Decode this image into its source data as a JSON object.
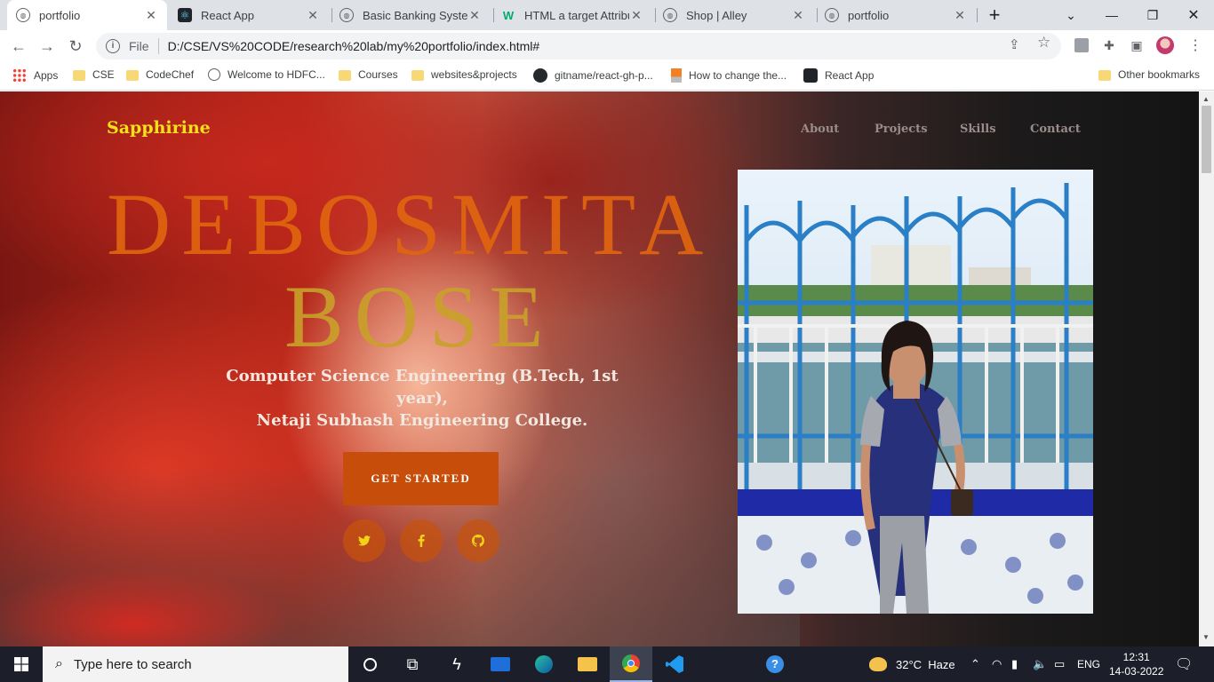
{
  "browser": {
    "tabs": [
      {
        "label": "portfolio",
        "active": true
      },
      {
        "label": "React App",
        "active": false
      },
      {
        "label": "Basic Banking System",
        "active": false
      },
      {
        "label": "HTML a target Attribu",
        "active": false
      },
      {
        "label": "Shop | Alley",
        "active": false
      },
      {
        "label": "portfolio",
        "active": false
      }
    ],
    "new_tab": "+",
    "address": {
      "scheme": "File",
      "url": "D:/CSE/VS%20CODE/research%20lab/my%20portfolio/index.html#"
    },
    "bookmarks": [
      {
        "label": "Apps",
        "icon": "apps-grid-icon"
      },
      {
        "label": "CSE",
        "icon": "folder-icon"
      },
      {
        "label": "CodeChef",
        "icon": "folder-icon"
      },
      {
        "label": "Welcome to HDFC...",
        "icon": "globe-icon"
      },
      {
        "label": "Courses",
        "icon": "folder-icon"
      },
      {
        "label": "websites&projects",
        "icon": "folder-icon"
      },
      {
        "label": "gitname/react-gh-p...",
        "icon": "github-icon"
      },
      {
        "label": "How to change the...",
        "icon": "stackoverflow-icon"
      },
      {
        "label": "React App",
        "icon": "react-icon"
      }
    ],
    "other_bookmarks": "Other bookmarks"
  },
  "site": {
    "brand": "Sapphirine",
    "nav": [
      "About",
      "Projects",
      "Skills",
      "Contact"
    ],
    "hero_first": "DEBOSMITA",
    "hero_last": "BOSE",
    "subtitle_line1": "Computer Science Engineering (B.Tech, 1st year),",
    "subtitle_line2": "Netaji Subhash Engineering College.",
    "cta": "GET STARTED",
    "social": [
      "twitter-icon",
      "facebook-icon",
      "github-icon"
    ],
    "colors": {
      "brand": "#f3e21a",
      "hero_first": "#e0650f",
      "hero_last": "#c9a12a",
      "cta": "#c74e0a"
    }
  },
  "taskbar": {
    "search_placeholder": "Type here to search",
    "weather": "32°C  Haze",
    "language": "ENG",
    "time": "12:31",
    "date": "14-03-2022"
  }
}
